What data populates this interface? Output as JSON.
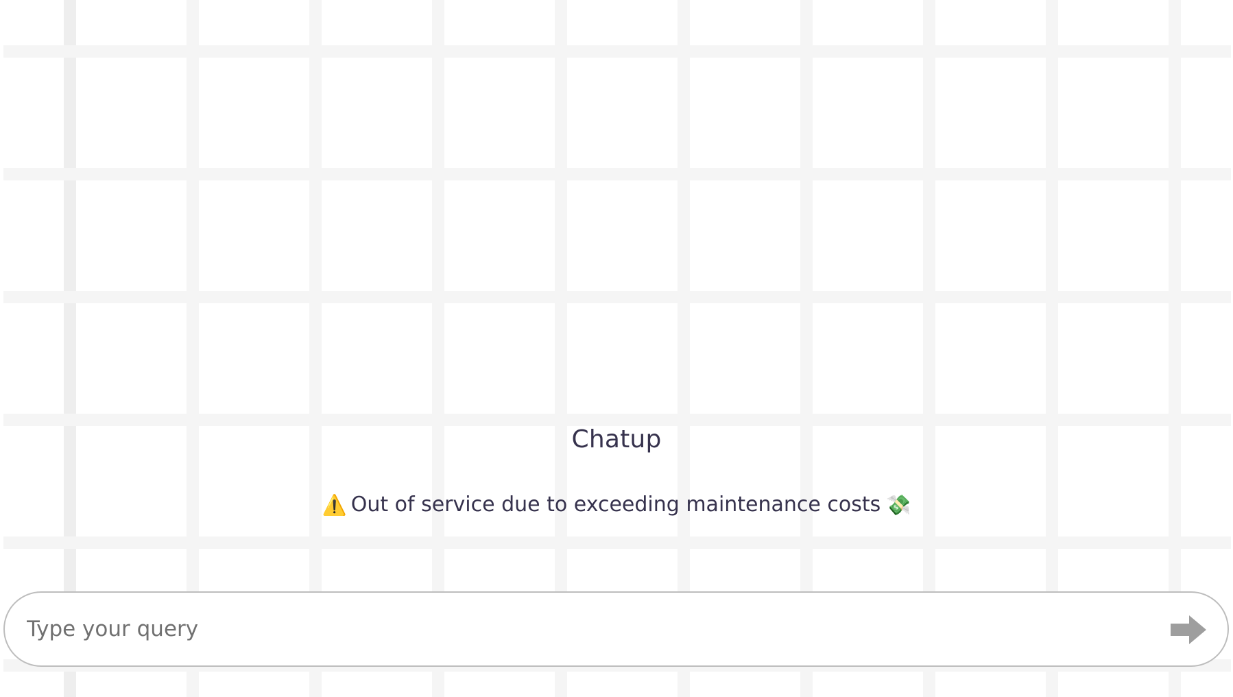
{
  "app": {
    "title": "Chatup",
    "notice": {
      "icon_left": "warning-icon",
      "icon_left_glyph": "⚠️",
      "text": "Out of service due to exceeding maintenance costs",
      "icon_right": "money-with-wings-icon",
      "icon_right_glyph": "💸"
    }
  },
  "query_bar": {
    "placeholder": "Type your query",
    "value": "",
    "send_icon": "arrow-right-icon"
  },
  "colors": {
    "background": "#ffffff",
    "grid_line": "#f5f5f5",
    "text": "#36324d",
    "placeholder": "#707070",
    "send_icon": "#9e9e9e",
    "input_border": "#bdbdbd"
  }
}
